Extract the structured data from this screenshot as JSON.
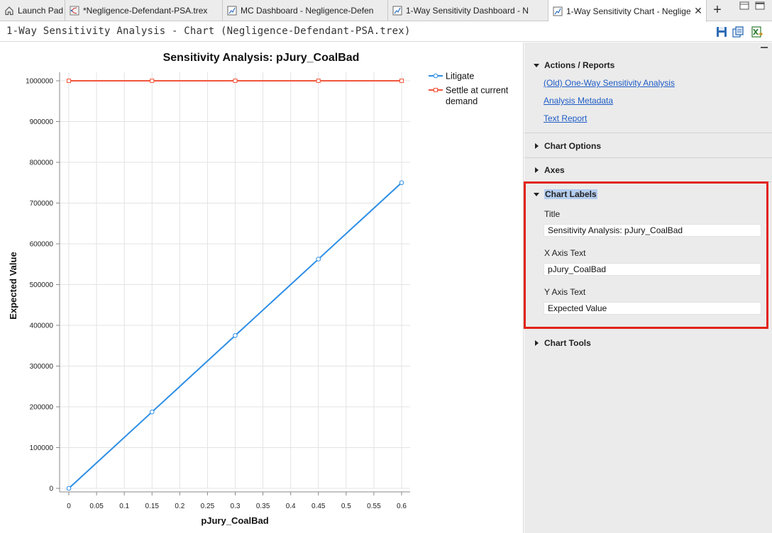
{
  "tabs": [
    {
      "label": "Launch Pad",
      "icon": "home-icon"
    },
    {
      "label": "*Negligence-Defendant-PSA.trex",
      "icon": "tree-model-icon"
    },
    {
      "label": "MC Dashboard - Negligence-Defen",
      "icon": "chart-doc-icon"
    },
    {
      "label": "1-Way Sensitivity Dashboard - N",
      "icon": "chart-doc-icon"
    },
    {
      "label": "1-Way Sensitivity Chart - Neglige",
      "icon": "chart-doc-icon",
      "active": true
    }
  ],
  "page_title": "1-Way Sensitivity Analysis - Chart (Negligence-Defendant-PSA.trex)",
  "toolbar": {
    "icons": [
      "save-icon",
      "copy-icon",
      "export-excel-icon"
    ]
  },
  "panel": {
    "actions_reports": {
      "title": "Actions / Reports",
      "links": [
        "(Old) One-Way Sensitivity Analysis",
        "Analysis Metadata",
        "Text Report"
      ]
    },
    "chart_options": {
      "title": "Chart Options"
    },
    "axes": {
      "title": "Axes"
    },
    "chart_labels": {
      "title": "Chart Labels",
      "title_label": "Title",
      "title_value": "Sensitivity Analysis: pJury_CoalBad",
      "x_label": "X Axis Text",
      "x_value": "pJury_CoalBad",
      "y_label": "Y Axis Text",
      "y_value": "Expected Value"
    },
    "chart_tools": {
      "title": "Chart Tools"
    }
  },
  "colors": {
    "litigate": "#2d8ee6",
    "settle": "#f0553c",
    "highlight": "#e2231a",
    "link": "#1f5cc6"
  },
  "chart_data": {
    "type": "line",
    "title": "Sensitivity Analysis: pJury_CoalBad",
    "xlabel": "pJury_CoalBad",
    "ylabel": "Expected Value",
    "xlim": [
      0,
      0.6
    ],
    "ylim": [
      0,
      1000000
    ],
    "x_ticks": [
      "0",
      "0.05",
      "0.1",
      "0.15",
      "0.2",
      "0.25",
      "0.3",
      "0.35",
      "0.4",
      "0.45",
      "0.5",
      "0.55",
      "0.6"
    ],
    "y_ticks": [
      "0",
      "100000",
      "200000",
      "300000",
      "400000",
      "500000",
      "600000",
      "700000",
      "800000",
      "900000",
      "1000000"
    ],
    "grid": true,
    "legend": "top-right",
    "x": [
      0,
      0.15,
      0.3,
      0.45,
      0.6
    ],
    "series": [
      {
        "name": "Litigate",
        "values": [
          0,
          187500,
          375000,
          562500,
          750000
        ],
        "marker": "circle"
      },
      {
        "name": "Settle at current demand",
        "values": [
          1000000,
          1000000,
          1000000,
          1000000,
          1000000
        ],
        "marker": "square"
      }
    ]
  }
}
